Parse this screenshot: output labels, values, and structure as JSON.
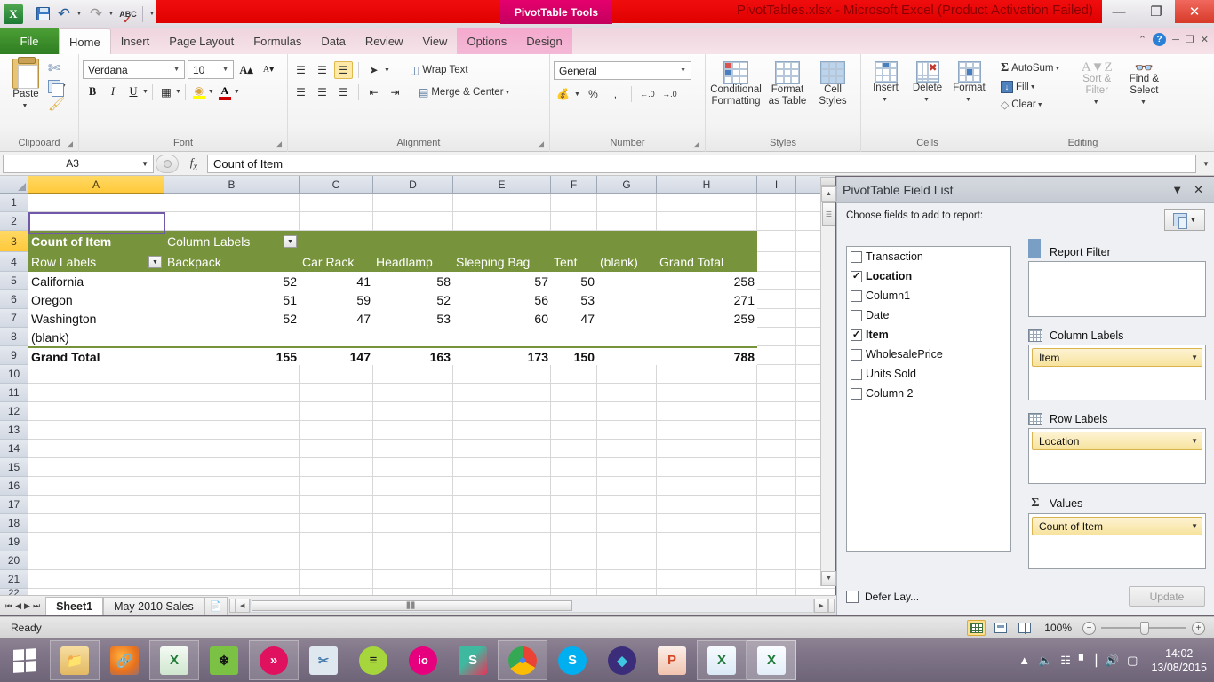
{
  "titlebar": {
    "app_icon": "excel-logo",
    "document_title": "PivotTables.xlsx - Microsoft Excel (Product Activation Failed)",
    "contextual_tab_group": "PivotTable Tools",
    "qat": [
      {
        "name": "save-icon",
        "label": "Save"
      },
      {
        "name": "undo-icon",
        "label": "Undo"
      },
      {
        "name": "redo-icon",
        "label": "Redo"
      },
      {
        "name": "spelling-icon",
        "label": "Spelling"
      },
      {
        "name": "customize-qat-icon",
        "label": "Customize Quick Access Toolbar"
      }
    ],
    "window_buttons": {
      "minimize": "—",
      "restore": "❐",
      "close": "✕"
    }
  },
  "ribbon_tabs": {
    "file": "File",
    "tabs": [
      "Home",
      "Insert",
      "Page Layout",
      "Formulas",
      "Data",
      "Review",
      "View"
    ],
    "active_tab": "Home",
    "contextual_tabs": [
      "Options",
      "Design"
    ],
    "help_buttons": {
      "minimize_ribbon": "⌃",
      "help": "?",
      "min": "─",
      "restore": "❐",
      "close": "✕"
    }
  },
  "ribbon": {
    "clipboard": {
      "label": "Clipboard",
      "paste": "Paste",
      "cut": "Cut",
      "copy": "Copy",
      "format_painter": "Format Painter"
    },
    "font": {
      "label": "Font",
      "font_name": "Verdana",
      "font_size": "10",
      "grow_font": "A",
      "shrink_font": "A",
      "bold": "B",
      "italic": "I",
      "underline": "U",
      "borders": "Borders",
      "fill_color": "◆",
      "fill_color_hex": "#ffff00",
      "font_color": "A",
      "font_color_hex": "#cc0000"
    },
    "alignment": {
      "label": "Alignment",
      "top_align": "Top Align",
      "middle_align": "Middle Align",
      "bottom_align": "Bottom Align",
      "orientation": "Orientation",
      "wrap_text": "Wrap Text",
      "align_left": "Align Left",
      "align_center": "Center",
      "align_right": "Align Right",
      "decrease_indent": "Decrease Indent",
      "increase_indent": "Increase Indent",
      "merge_center": "Merge & Center"
    },
    "number": {
      "label": "Number",
      "format": "General",
      "accounting": "Accounting Number Format",
      "percent": "%",
      "comma": ",",
      "increase_decimal": ".00",
      "decrease_decimal": ".00"
    },
    "styles": {
      "label": "Styles",
      "conditional_formatting": "Conditional Formatting",
      "format_as_table": "Format as Table",
      "cell_styles": "Cell Styles"
    },
    "cells": {
      "label": "Cells",
      "insert": "Insert",
      "delete": "Delete",
      "format": "Format"
    },
    "editing": {
      "label": "Editing",
      "autosum": "AutoSum",
      "fill": "Fill",
      "clear": "Clear",
      "sort_filter": "Sort & Filter",
      "find_select": "Find & Select"
    }
  },
  "formula_bar": {
    "name_box": "A3",
    "fx_label": "fx",
    "content": "Count of Item"
  },
  "sheet": {
    "column_headers": [
      "A",
      "B",
      "C",
      "D",
      "E",
      "F",
      "G",
      "H",
      "I"
    ],
    "selected_column": "A",
    "selected_row": 3,
    "row_headers": [
      1,
      2,
      3,
      4,
      5,
      6,
      7,
      8,
      9,
      10,
      11,
      12,
      13,
      14,
      15,
      16,
      17,
      18,
      19,
      20,
      21,
      22
    ],
    "pivot": {
      "title_cell": "Count of Item",
      "column_labels_cell": "Column Labels",
      "row_labels_cell": "Row Labels",
      "header_bg_hex": "#77933c",
      "columns": [
        "Backpack",
        "Car Rack",
        "Headlamp",
        "Sleeping Bag",
        "Tent",
        "(blank)",
        "Grand Total"
      ],
      "rows": [
        {
          "label": "California",
          "values": [
            "52",
            "41",
            "58",
            "57",
            "50",
            "",
            "258"
          ]
        },
        {
          "label": "Oregon",
          "values": [
            "51",
            "59",
            "52",
            "56",
            "53",
            "",
            "271"
          ]
        },
        {
          "label": "Washington",
          "values": [
            "52",
            "47",
            "53",
            "60",
            "47",
            "",
            "259"
          ]
        },
        {
          "label": "(blank)",
          "values": [
            "",
            "",
            "",
            "",
            "",
            "",
            ""
          ]
        }
      ],
      "grand_total_label": "Grand Total",
      "grand_total_values": [
        "155",
        "147",
        "163",
        "173",
        "150",
        "",
        "788"
      ]
    }
  },
  "field_list": {
    "title": "PivotTable Field List",
    "collapse_icon": "▼",
    "close_icon": "✕",
    "choose_label": "Choose fields to add to report:",
    "fields_button": "field-list-layout-button",
    "fields": [
      {
        "label": "Transaction",
        "checked": false
      },
      {
        "label": "Location",
        "checked": true
      },
      {
        "label": "Column1",
        "checked": false
      },
      {
        "label": "Date",
        "checked": false
      },
      {
        "label": "Item",
        "checked": true
      },
      {
        "label": "WholesalePrice",
        "checked": false
      },
      {
        "label": "Units Sold",
        "checked": false
      },
      {
        "label": "Column 2",
        "checked": false
      }
    ],
    "zones": [
      {
        "name": "report-filter",
        "label": "Report Filter",
        "icon": "filter-icon",
        "items": []
      },
      {
        "name": "column-labels",
        "label": "Column Labels",
        "icon": "table-icon",
        "items": [
          "Item"
        ]
      },
      {
        "name": "row-labels",
        "label": "Row Labels",
        "icon": "table-icon",
        "items": [
          "Location"
        ]
      },
      {
        "name": "values",
        "label": "Values",
        "icon": "sigma-icon",
        "items": [
          "Count of Item"
        ]
      }
    ],
    "defer_label": "Defer Lay...",
    "update_button": "Update"
  },
  "sheet_tabs": {
    "tabs": [
      {
        "label": "Sheet1",
        "active": true
      },
      {
        "label": "May 2010 Sales",
        "active": false
      }
    ],
    "insert_sheet": "➕",
    "nav_first": "⏮",
    "nav_prev": "◀",
    "nav_next": "▶",
    "nav_last": "⏭"
  },
  "status_bar": {
    "status": "Ready",
    "views": [
      "Normal",
      "Page Layout",
      "Page Break Preview"
    ],
    "active_view": "Normal",
    "zoom": "100%",
    "zoom_out": "−",
    "zoom_in": "+"
  },
  "taskbar": {
    "start": "start-button",
    "items": [
      {
        "name": "file-explorer-icon",
        "glyph": "🗂",
        "bg": "#f0c267",
        "fg": "#6b4a14",
        "open": true
      },
      {
        "name": "firefox-icon",
        "glyph": "",
        "bg": "#e8721f",
        "fg": "#ffffff",
        "open": false
      },
      {
        "name": "excel-icon",
        "glyph": "X",
        "bg": "#e9f3e9",
        "fg": "#1d7a35",
        "open": true
      },
      {
        "name": "sourcetree-icon",
        "glyph": "",
        "bg": "#7bc143",
        "fg": "#1a1a1a",
        "open": false
      },
      {
        "name": "poedit-icon",
        "glyph": "»",
        "bg": "#e0115f",
        "fg": "#ffffff",
        "open": true
      },
      {
        "name": "snipping-tool-icon",
        "glyph": "✂",
        "bg": "#dfe7ef",
        "fg": "#4a7fae",
        "open": false
      },
      {
        "name": "spotify-icon",
        "glyph": "≡",
        "bg": "#a6d63c",
        "fg": "#1a1a1a",
        "open": false
      },
      {
        "name": "io-icon",
        "glyph": "io",
        "bg": "#e6007e",
        "fg": "#ffffff",
        "open": false
      },
      {
        "name": "slack-icon",
        "glyph": "S",
        "bg": "#f0f0f0",
        "fg": "#333333",
        "open": false
      },
      {
        "name": "chrome-icon",
        "glyph": "",
        "bg": "#f5f5f5",
        "fg": "#4285f4",
        "open": true
      },
      {
        "name": "skype-icon",
        "glyph": "S",
        "bg": "#00aff0",
        "fg": "#ffffff",
        "open": false
      },
      {
        "name": "rainbow-icon",
        "glyph": "",
        "bg": "#3b2d7a",
        "fg": "#3ec8e0",
        "open": false
      },
      {
        "name": "powerpoint-icon",
        "glyph": "P",
        "bg": "#f6e3da",
        "fg": "#d24726",
        "open": false
      },
      {
        "name": "excel-doc-1-icon",
        "glyph": "X",
        "bg": "#eef5fb",
        "fg": "#1d7a35",
        "open": true
      },
      {
        "name": "excel-doc-2-icon",
        "glyph": "X",
        "bg": "#eef5fb",
        "fg": "#1d7a35",
        "open": true
      }
    ],
    "tray": {
      "show_hidden": "▲",
      "volume_mute": "🔊",
      "action_center": "❖",
      "network": "▃",
      "volume": "🔊",
      "battery": "🔋"
    },
    "time": "14:02",
    "date": "13/08/2015"
  }
}
